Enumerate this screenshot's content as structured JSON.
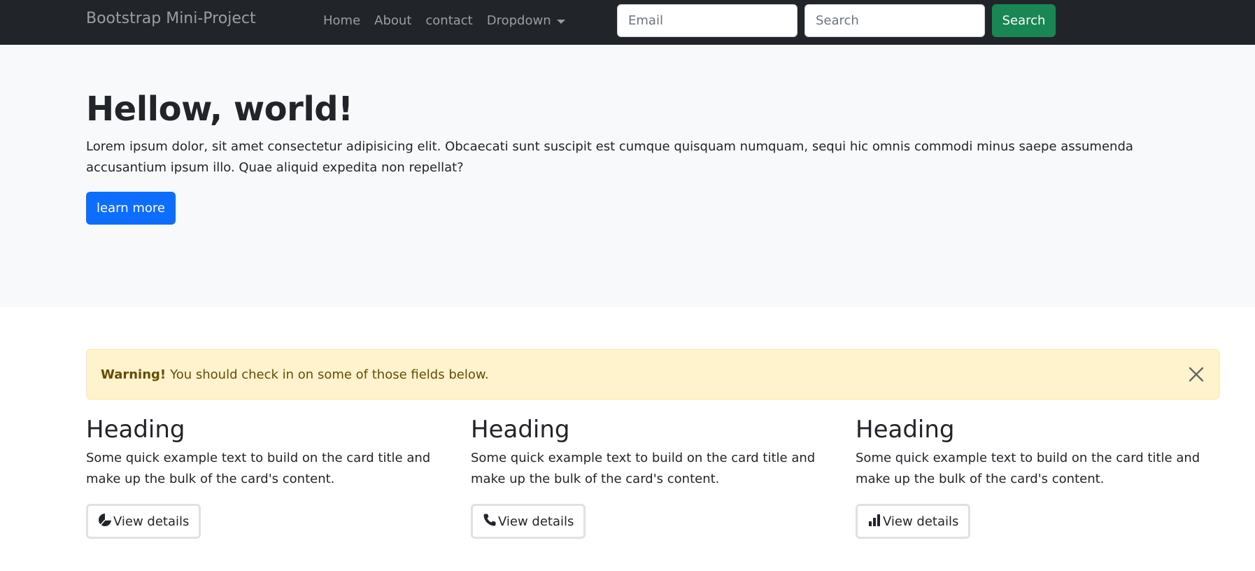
{
  "navbar": {
    "brand": "Bootstrap Mini-Project",
    "links": [
      "Home",
      "About",
      "contact"
    ],
    "dropdown_label": "Dropdown",
    "email_placeholder": "Email",
    "search_placeholder": "Search",
    "search_button": "Search"
  },
  "hero": {
    "title": "Hellow, world!",
    "text": "Lorem ipsum dolor, sit amet consectetur adipisicing elit. Obcaecati sunt suscipit est cumque quisquam numquam, sequi hic omnis commodi minus saepe assumenda accusantium ipsum illo. Quae aliquid expedita non repellat?",
    "button": "learn more"
  },
  "alert": {
    "strong": "Warning!",
    "message": "You should check in on some of those fields below."
  },
  "cards": [
    {
      "heading": "Heading",
      "text": "Some quick example text to build on the card title and make up the bulk of the card's content.",
      "button": "View details",
      "icon": "pie-chart-icon"
    },
    {
      "heading": "Heading",
      "text": "Some quick example text to build on the card title and make up the bulk of the card's content.",
      "button": "View details",
      "icon": "phone-icon"
    },
    {
      "heading": "Heading",
      "text": "Some quick example text to build on the card title and make up the bulk of the card's content.",
      "button": "View details",
      "icon": "bar-chart-icon"
    }
  ],
  "colors": {
    "navbar_bg": "#212529",
    "hero_bg": "#f8f9fa",
    "primary": "#0d6efd",
    "success": "#198754",
    "warning_bg": "#fff3cd",
    "warning_text": "#664d03"
  }
}
